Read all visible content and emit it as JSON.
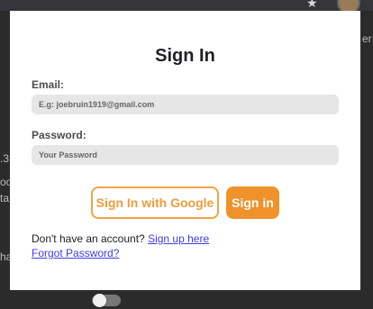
{
  "background": {
    "left_snippets": [
      ".3",
      "oo",
      "ta",
      "ha"
    ],
    "right_snippet": "er n"
  },
  "modal": {
    "title": "Sign In",
    "email": {
      "label": "Email:",
      "placeholder": "E.g: joebruin1919@gmail.com",
      "value": ""
    },
    "password": {
      "label": "Password:",
      "placeholder": "Your Password",
      "value": ""
    },
    "google_button_label": "Sign In with Google",
    "signin_button_label": "Sign in",
    "signup_prompt": "Don't have an account?",
    "signup_link": "Sign up here",
    "forgot_link": "Forgot Password?"
  },
  "colors": {
    "accent": "#f0922c",
    "google_outline": "#f0a447",
    "link": "#3f3ce6",
    "modal_background": "#ffffff",
    "backdrop": "#2b2b2b"
  },
  "icons": {
    "toolbar_star": "star-icon",
    "toolbar_extension": "extension-avatar-icon"
  }
}
